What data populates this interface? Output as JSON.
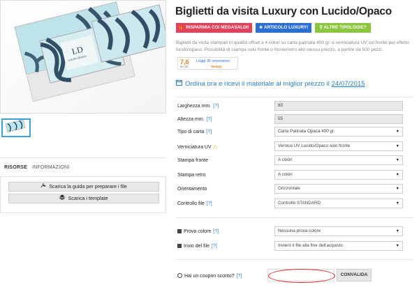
{
  "product": {
    "title": "Biglietti da visita Luxury con Lucido/Opaco",
    "badges": [
      "RISPARMIA COI MEGASALDI!",
      "ARTICOLO LUXURY!",
      "ALTRE TIPOLOGIE?"
    ],
    "badge_icons": [
      "gift-icon",
      "star-icon",
      "search-icon"
    ],
    "description": "Biglietti da visita stampati in qualità offset a 4 colori su carta patinata 400 gr. e verniciatura UV sul fronte per effetto lucido/opaco. Possibilità di stampa solo fronte o fronte/retro allo stesso prezzo, a partire da 500 pezzi.",
    "rating": {
      "score": "7,6",
      "of": "su 10",
      "reviews": "Leggi 35 recensioni",
      "brand": "feedaty"
    },
    "order_text": "Ordina ora e ricevi il materiale al miglior prezzo il",
    "order_date": "24/07/2015"
  },
  "image": {
    "card_initials": "LD",
    "card_subtitle": "LUXURY DESIGN"
  },
  "tabs": [
    "RISORSE",
    "INFORMAZIONI"
  ],
  "resources": {
    "guide_label": "Scarica la guida per preparare i file",
    "template_label": "Scarica i template"
  },
  "form": {
    "help": "[?]",
    "fields": [
      {
        "label": "Larghezza mm.",
        "value": "85"
      },
      {
        "label": "Altezza mm.",
        "value": "55"
      },
      {
        "label": "Tipo di carta",
        "value": "Carta Patinata Opaca 400 gr."
      },
      {
        "label": "Verniciatura UV",
        "value": "Vernice UV Lucido/Opaco solo fronte"
      },
      {
        "label": "Stampa fronte",
        "value": "A colori"
      },
      {
        "label": "Stampa retro",
        "value": "A colori"
      },
      {
        "label": "Orientamento",
        "value": "Orizzontale"
      },
      {
        "label": "Controllo file",
        "value": "Controllo STANDARD"
      }
    ],
    "extras": [
      {
        "label": "Prova colore",
        "value": "Nessuna prova colore"
      },
      {
        "label": "Invio del file",
        "value": "Invierò il file alla fine dell'acquisto"
      }
    ],
    "coupon_label": "Hai un coupon sconto?",
    "coupon_value": "",
    "validate_label": "CONVALIDA"
  },
  "colors": {
    "accent": "#2c7fc4",
    "badge_red": "#e3405b",
    "badge_blue": "#2c6fd4",
    "badge_green": "#8cc63e"
  }
}
